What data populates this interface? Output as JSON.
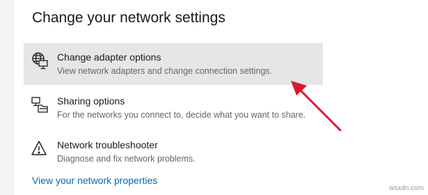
{
  "header": {
    "title": "Change your network settings"
  },
  "options": [
    {
      "title": "Change adapter options",
      "description": "View network adapters and change connection settings.",
      "icon": "globe-monitor-icon"
    },
    {
      "title": "Sharing options",
      "description": "For the networks you connect to, decide what you want to share.",
      "icon": "sharing-icon"
    },
    {
      "title": "Network troubleshooter",
      "description": "Diagnose and fix network problems.",
      "icon": "warning-icon"
    }
  ],
  "footer": {
    "link": "View your network properties"
  },
  "annotation": {
    "color": "#e0162b"
  },
  "watermark": "wsxdn.com",
  "colors": {
    "link": "#0067b8",
    "highlight": "#e6e6e6"
  }
}
